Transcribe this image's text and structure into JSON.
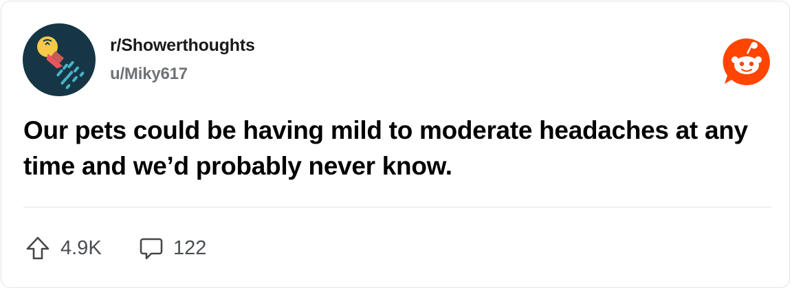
{
  "post": {
    "subreddit": "r/Showerthoughts",
    "username": "u/Miky617",
    "title": "Our pets could be having mild to moderate headaches at any time and we’d probably never know."
  },
  "actions": {
    "upvotes": "4.9K",
    "comments": "122"
  },
  "icons": {
    "avatar": "shower-head-lightbulb-icon",
    "brand": "reddit-snoo-icon",
    "upvote": "upvote-arrow-icon",
    "comment": "comment-bubble-icon"
  },
  "colors": {
    "avatar_background": "#163646",
    "reddit_orange": "#ff4500",
    "text_primary": "#000000",
    "text_secondary": "#6f7375"
  }
}
